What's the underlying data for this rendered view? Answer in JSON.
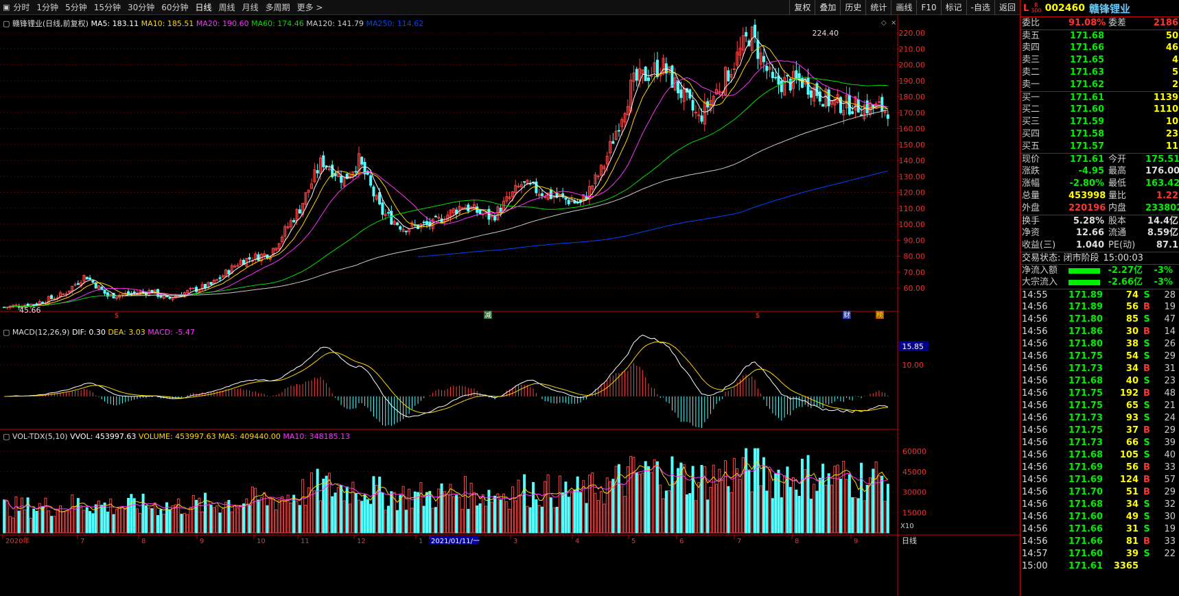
{
  "toolbar": {
    "items": [
      "分时",
      "1分钟",
      "5分钟",
      "15分钟",
      "30分钟",
      "60分钟",
      "日线",
      "周线",
      "月线",
      "多周期",
      "更多 >"
    ],
    "active": "日线",
    "right": [
      "复权",
      "叠加",
      "历史",
      "统计",
      "画线",
      "F10",
      "标记",
      "-自选",
      "返回"
    ]
  },
  "stock": {
    "code": "002460",
    "name": "赣锋锂业",
    "badge": "L",
    "badge_r": "R",
    "badge_300": "300"
  },
  "legend": {
    "main": {
      "title": "赣锋锂业(日线,前复权)",
      "ma": [
        [
          "MA5: 183.11",
          "#ffffff"
        ],
        [
          "MA10: 185.51",
          "#ffd700"
        ],
        [
          "MA20: 190.60",
          "#ff33ff"
        ],
        [
          "MA60: 174.46",
          "#00e000"
        ],
        [
          "MA120: 141.79",
          "#cccccc"
        ],
        [
          "MA250: 114.62",
          "#0044ff"
        ]
      ]
    },
    "macd": {
      "title": "MACD(12,26,9)",
      "items": [
        [
          "DIF: 0.30",
          "#ffffff"
        ],
        [
          "DEA: 3.03",
          "#ffd700"
        ],
        [
          "MACD: -5.47",
          "#ff33ff"
        ]
      ]
    },
    "vol": {
      "title": "VOL-TDX(5,10)",
      "items": [
        [
          "VVOL: 453997.63",
          "#ffffff"
        ],
        [
          "VOLUME: 453997.63",
          "#ffd700"
        ],
        [
          "MA5: 409440.00",
          "#ffd700"
        ],
        [
          "MA10: 348185.13",
          "#ff33ff"
        ]
      ]
    }
  },
  "axis": {
    "price_ticks": [
      "220.00",
      "210.00",
      "200.00",
      "190.00",
      "180.00",
      "170.00",
      "160.00",
      "150.00",
      "140.00",
      "130.00",
      "120.00",
      "110.00",
      "100.00",
      "90.00",
      "80.00",
      "70.00",
      "60.00"
    ],
    "macd_ticks": [
      "15.85",
      "10.00"
    ],
    "vol_ticks": [
      "60000",
      "45000",
      "30000",
      "15000"
    ],
    "vol_unit": "X10",
    "dates": [
      "2020年",
      "7",
      "8",
      "9",
      "10",
      "11",
      "12",
      "1",
      "2021/01/11/一",
      "3",
      "4",
      "5",
      "6",
      "7",
      "8",
      "9"
    ],
    "period_label": "日线",
    "high_label": "224.40",
    "low_label": "45.66",
    "markers": [
      "$",
      "减",
      "$",
      "财",
      "榜"
    ]
  },
  "quote": {
    "wb": {
      "label": "委比",
      "val": "91.08%",
      "label2": "委差",
      "val2": "2186"
    },
    "sell": [
      [
        "卖五",
        "171.68",
        "50"
      ],
      [
        "卖四",
        "171.66",
        "46"
      ],
      [
        "卖三",
        "171.65",
        "4"
      ],
      [
        "卖二",
        "171.63",
        "5"
      ],
      [
        "卖一",
        "171.62",
        "2"
      ]
    ],
    "buy": [
      [
        "买一",
        "171.61",
        "1139"
      ],
      [
        "买二",
        "171.60",
        "1110"
      ],
      [
        "买三",
        "171.59",
        "10"
      ],
      [
        "买四",
        "171.58",
        "23"
      ],
      [
        "买五",
        "171.57",
        "11"
      ]
    ],
    "stats": [
      [
        [
          "现价",
          "171.61",
          "green"
        ],
        [
          "今开",
          "175.51",
          "green"
        ]
      ],
      [
        [
          "涨跌",
          "-4.95",
          "green"
        ],
        [
          "最高",
          "176.00",
          "white"
        ]
      ],
      [
        [
          "涨幅",
          "-2.80%",
          "green"
        ],
        [
          "最低",
          "163.42",
          "green"
        ]
      ],
      [
        [
          "总量",
          "453998",
          "yellow"
        ],
        [
          "量比",
          "1.22",
          "red"
        ]
      ],
      [
        [
          "外盘",
          "220196",
          "red"
        ],
        [
          "内盘",
          "233802",
          "green"
        ]
      ]
    ],
    "stats2": [
      [
        [
          "换手",
          "5.28%",
          "white"
        ],
        [
          "股本",
          "14.4亿",
          "white"
        ]
      ],
      [
        [
          "净资",
          "12.66",
          "white"
        ],
        [
          "流通",
          "8.59亿",
          "white"
        ]
      ],
      [
        [
          "收益(三)",
          "1.040",
          "white"
        ],
        [
          "PE(动)",
          "87.1",
          "white"
        ]
      ]
    ],
    "status": {
      "label": "交易状态: 闭市阶段",
      "time": "15:00:03"
    },
    "flows": [
      [
        "净流入额",
        "-2.27亿",
        "-3%"
      ],
      [
        "大宗流入",
        "-2.66亿",
        "-3%"
      ]
    ]
  },
  "trades": [
    [
      "14:55",
      "171.89",
      "74",
      "S",
      "28"
    ],
    [
      "14:56",
      "171.89",
      "56",
      "B",
      "19"
    ],
    [
      "14:56",
      "171.80",
      "85",
      "S",
      "47"
    ],
    [
      "14:56",
      "171.86",
      "30",
      "B",
      "14"
    ],
    [
      "14:56",
      "171.80",
      "38",
      "S",
      "26"
    ],
    [
      "14:56",
      "171.75",
      "54",
      "S",
      "29"
    ],
    [
      "14:56",
      "171.73",
      "34",
      "B",
      "31"
    ],
    [
      "14:56",
      "171.68",
      "40",
      "S",
      "23"
    ],
    [
      "14:56",
      "171.75",
      "192",
      "B",
      "48"
    ],
    [
      "14:56",
      "171.75",
      "65",
      "S",
      "21"
    ],
    [
      "14:56",
      "171.73",
      "93",
      "S",
      "24"
    ],
    [
      "14:56",
      "171.75",
      "37",
      "B",
      "29"
    ],
    [
      "14:56",
      "171.73",
      "66",
      "S",
      "39"
    ],
    [
      "14:56",
      "171.68",
      "105",
      "S",
      "40"
    ],
    [
      "14:56",
      "171.69",
      "56",
      "B",
      "33"
    ],
    [
      "14:56",
      "171.69",
      "124",
      "B",
      "57"
    ],
    [
      "14:56",
      "171.70",
      "51",
      "B",
      "29"
    ],
    [
      "14:56",
      "171.68",
      "34",
      "S",
      "32"
    ],
    [
      "14:56",
      "171.60",
      "49",
      "S",
      "30"
    ],
    [
      "14:56",
      "171.66",
      "31",
      "S",
      "19"
    ],
    [
      "14:56",
      "171.66",
      "81",
      "B",
      "33"
    ],
    [
      "14:57",
      "171.60",
      "39",
      "S",
      "22"
    ],
    [
      "15:00",
      "171.61",
      "3365",
      "",
      ""
    ]
  ]
}
